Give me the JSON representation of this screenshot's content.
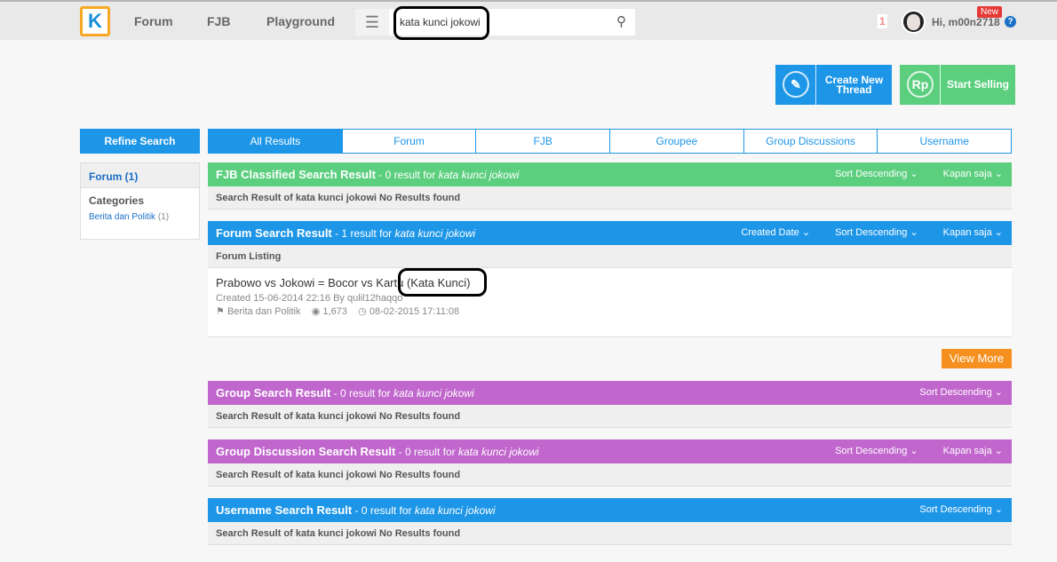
{
  "header": {
    "logo": "K",
    "nav": [
      "Forum",
      "FJB",
      "Playground"
    ],
    "search_value": "kata kunci jokowi",
    "notif_count": "1",
    "greeting": "Hi, m00n2718",
    "new_badge": "New",
    "help": "?"
  },
  "actions": {
    "create_thread": "Create New Thread",
    "start_selling": "Start Selling",
    "rp_icon": "Rp"
  },
  "sidebar": {
    "refine": "Refine Search",
    "forum_filter": "Forum (1)",
    "categories_title": "Categories",
    "category": "Berita dan Politik",
    "category_count": "(1)"
  },
  "tabs": [
    "All Results",
    "Forum",
    "FJB",
    "Groupee",
    "Group Discussions",
    "Username"
  ],
  "sections": {
    "fjb": {
      "title": "FJB Classified Search Result",
      "count": " - 0 result for ",
      "query": "kata kunci jokowi",
      "sort": "Sort Descending",
      "time": "Kapan saja",
      "note": "Search Result of kata kunci jokowi No Results found"
    },
    "forum": {
      "title": "Forum Search Result",
      "count": " - 1 result for ",
      "query": "kata kunci jokowi",
      "created": "Created Date",
      "sort": "Sort Descending",
      "time": "Kapan saja",
      "listing": "Forum Listing",
      "item": {
        "title": "Prabowo vs Jokowi = Bocor vs Kartu (Kata Kunci)",
        "created": "Created 15-06-2014 22:16 By qulil12haqqo",
        "category": "Berita dan Politik",
        "views": "1,673",
        "last": "08-02-2015 17:11:08"
      },
      "view_more": "View More"
    },
    "group": {
      "title": "Group Search Result",
      "count": " - 0 result for ",
      "query": "kata kunci jokowi",
      "sort": "Sort Descending",
      "note": "Search Result of kata kunci jokowi No Results found"
    },
    "group_disc": {
      "title": "Group Discussion Search Result",
      "count": " - 0 result for ",
      "query": "kata kunci jokowi",
      "sort": "Sort Descending",
      "time": "Kapan saja",
      "note": "Search Result of kata kunci jokowi No Results found"
    },
    "username": {
      "title": "Username Search Result",
      "count": " - 0 result for ",
      "query": "kata kunci jokowi",
      "sort": "Sort Descending",
      "note": "Search Result of kata kunci jokowi No Results found"
    }
  },
  "colors": {
    "blue": "#1e96e8",
    "green": "#5ccf7f",
    "purple": "#c066cc",
    "orange": "#f5901f"
  }
}
